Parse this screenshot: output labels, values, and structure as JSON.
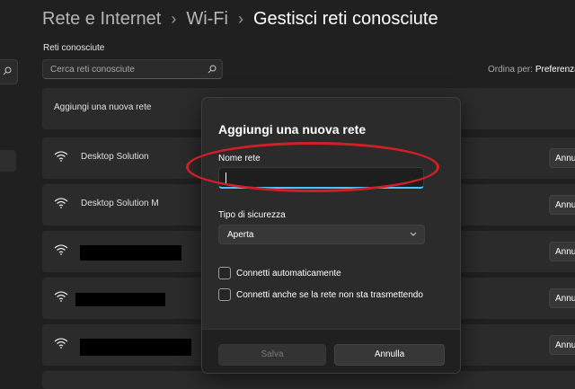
{
  "breadcrumb": {
    "items": [
      "Rete e Internet",
      "Wi-Fi"
    ],
    "separator": "›",
    "current": "Gestisci reti conosciute"
  },
  "known_networks": {
    "section_label": "Reti conosciute",
    "search_placeholder": "Cerca reti conosciute",
    "sort_label": "Ordina per:",
    "sort_value": "Preferenza",
    "add_network_label": "Aggiungi una nuova rete",
    "networks": [
      {
        "name": "Desktop Solution",
        "action": "Annulla"
      },
      {
        "name": "Desktop Solution M",
        "action": "Annulla"
      },
      {
        "name": "",
        "action": "Annulla"
      },
      {
        "name": "",
        "action": "Annulla"
      },
      {
        "name": "",
        "action": "Annulla"
      }
    ]
  },
  "dialog": {
    "title": "Aggiungi una nuova rete",
    "network_name_label": "Nome rete",
    "network_name_value": "",
    "security_label": "Tipo di sicurezza",
    "security_value": "Aperta",
    "auto_connect_label": "Connetti automaticamente",
    "auto_connect_checked": false,
    "hidden_connect_label": "Connetti anche se la rete non sta trasmettendo",
    "hidden_connect_checked": false,
    "save_label": "Salva",
    "cancel_label": "Annulla"
  },
  "icons": {
    "search": "search-icon",
    "wifi": "wifi-icon",
    "chevron": "chevron-down-icon"
  },
  "colors": {
    "background": "#202020",
    "card": "#2b2b2b",
    "accent": "#4cc2ff",
    "annotation": "#d11f27"
  }
}
